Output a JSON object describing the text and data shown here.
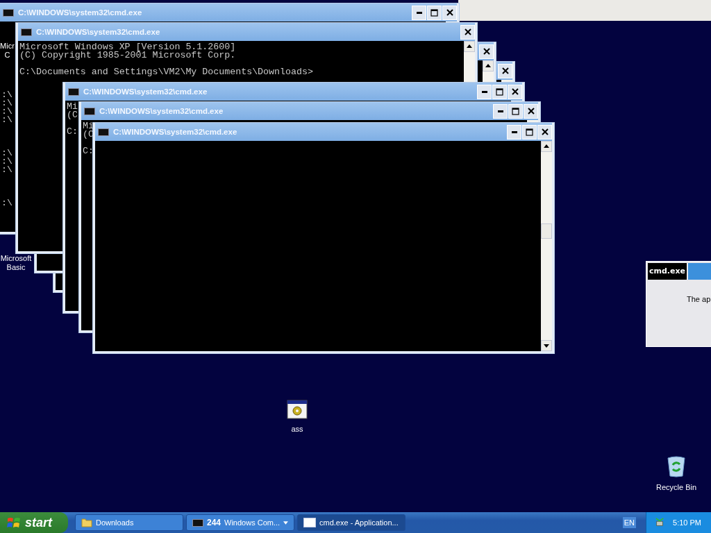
{
  "windows": [
    {
      "title": "C:\\WINDOWS\\system32\\cmd.exe",
      "buttons": [
        {
          "kind": "minimize"
        },
        {
          "kind": "maximize"
        },
        {
          "kind": "close"
        }
      ],
      "blocks": [
        [
          ":\\",
          ":\\",
          ":\\",
          ":\\"
        ],
        [
          ":\\",
          ":\\",
          ":\\"
        ],
        [
          ":\\"
        ]
      ]
    },
    {
      "title": "C:\\WINDOWS\\system32\\cmd.exe",
      "buttons": [
        {
          "kind": "close"
        }
      ],
      "blocks": [
        [
          "Microsoft Windows XP [Version 5.1.2600]",
          "(C) Copyright 1985-2001 Microsoft Corp."
        ],
        [
          "C:\\Documents and Settings\\VM2\\My Documents\\Downloads>"
        ]
      ]
    },
    {
      "buttons": [
        {
          "kind": "close"
        }
      ]
    },
    {
      "buttons": [
        {
          "kind": "close"
        }
      ]
    },
    {
      "title": "C:\\WINDOWS\\system32\\cmd.exe",
      "buttons": [
        {
          "kind": "minimize"
        },
        {
          "kind": "maximize"
        },
        {
          "kind": "close"
        }
      ],
      "blocks": [
        [
          "Mi",
          "(C"
        ],
        [
          "C:"
        ]
      ]
    },
    {
      "title": "C:\\WINDOWS\\system32\\cmd.exe",
      "buttons": [
        {
          "kind": "minimize"
        },
        {
          "kind": "maximize"
        },
        {
          "kind": "close"
        }
      ],
      "blocks": [
        [
          "Mi",
          "(C"
        ],
        [
          "C:"
        ]
      ]
    },
    {
      "title": "C:\\WINDOWS\\system32\\cmd.exe",
      "buttons": [
        {
          "kind": "minimize"
        },
        {
          "kind": "maximize"
        },
        {
          "kind": "close"
        }
      ]
    }
  ],
  "desktop_icons": [
    {
      "kind": "label-only",
      "lines": [
        "Micr",
        "C"
      ]
    },
    {
      "kind": "label-only",
      "lines": [
        "Microsoft",
        "Basic"
      ]
    },
    {
      "kind": "program",
      "lines": [
        "ass"
      ]
    },
    {
      "kind": "recycle-bin",
      "lines": [
        "Recycle Bin"
      ]
    }
  ],
  "dialog": {
    "tab": "cmd.exe",
    "message": "The ap"
  },
  "taskbar": {
    "start": "start",
    "items": [
      {
        "kind": "folder",
        "label": "Downloads",
        "selected": false
      },
      {
        "kind": "group",
        "count": "244",
        "label": "Windows Com...",
        "selected": false
      },
      {
        "kind": "window",
        "label": "cmd.exe - Application...",
        "selected": true
      }
    ],
    "language": "EN",
    "clock": "5:10 PM"
  }
}
